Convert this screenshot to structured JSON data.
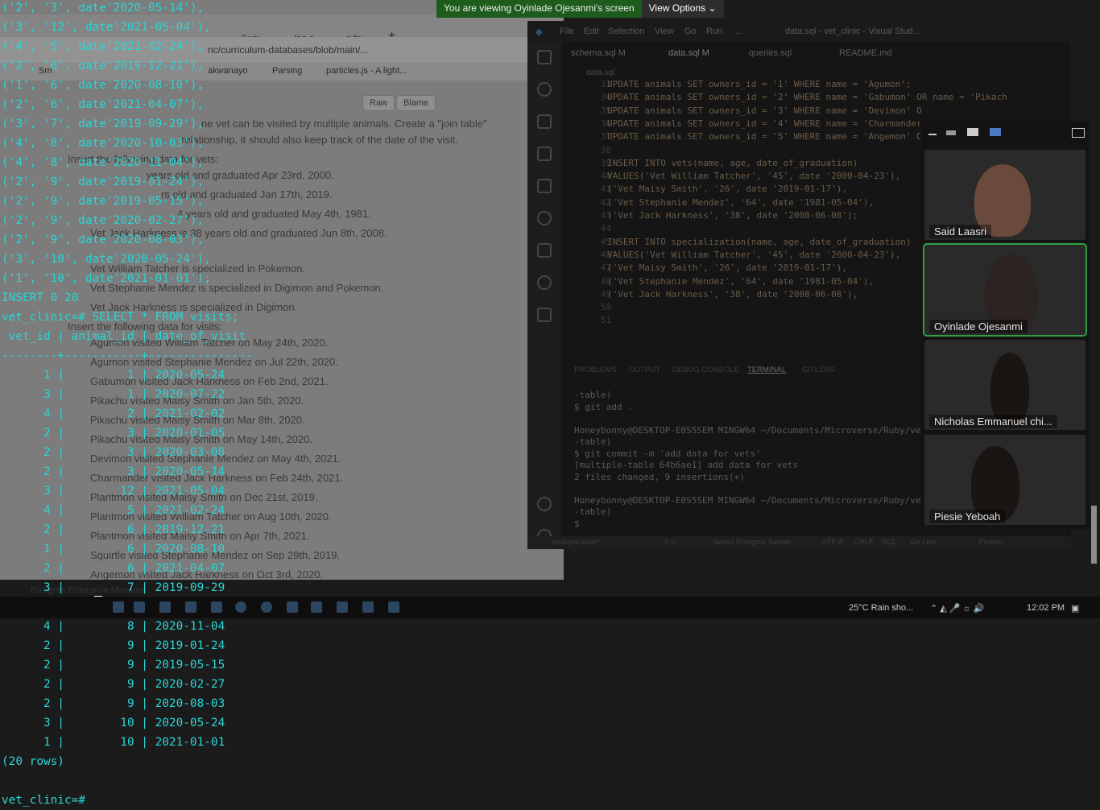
{
  "browser": {
    "tabs": [
      "Sum",
      "(no s",
      "ruby"
    ],
    "address": "nc/curriculum-databases/blob/main/...",
    "bookmarks": [
      "Sm",
      "akwanayo",
      "Parsing",
      "particles.js - A light..."
    ],
    "buttons": {
      "raw": "Raw",
      "blame": "Blame"
    },
    "doc_lines": [
      "ne vet can be visited by multiple animals. Create a \"join table\"",
      "relationship, it should also keep track of the date of the visit.",
      "Insert the following data for vets:",
      "years old and graduated Apr 23rd, 2000.",
      "rs old and graduated Jan 17th, 2019.",
      "4 years old and graduated May 4th, 1981.",
      "Vet Jack Harkness is 38 years old and graduated Jun 8th, 2008.",
      "Vet William Tatcher is specialized in Pokemon.",
      "Vet Stephanie Mendez is specialized in Digimon and Pokemon.",
      "Vet Jack Harkness is specialized in Digimon.",
      "Insert the following data for visits:",
      "Agumon visited William Tatcher on May 24th, 2020.",
      "Agumon visited Stephanie Mendez on Jul 22th, 2020.",
      "Gabumon visited Jack Harkness on Feb 2nd, 2021.",
      "Pikachu visited Maisy Smith on Jan 5th, 2020.",
      "Pikachu visited Maisy Smith on Mar 8th, 2020.",
      "Pikachu visited Maisy Smith on May 14th, 2020.",
      "Devimon visited Stephanie Mendez on May 4th, 2021.",
      "Charmander visited Jack Harkness on Feb 24th, 2021.",
      "Plantmon visited Maisy Smith on Dec 21st, 2019.",
      "Plantmon visited William Tatcher on Aug 10th, 2020.",
      "Plantmon visited Maisy Smith on Apr 7th, 2021.",
      "Squirtle visited Stephanie Mendez on Sep 29th, 2019.",
      "Angemon visited Jack Harkness on Oct 3rd, 2020."
    ],
    "pgadmin": "Postgres Enterprise Manager"
  },
  "vscode": {
    "menu": [
      "File",
      "Edit",
      "Selection",
      "View",
      "Go",
      "Run",
      "..."
    ],
    "window_title": "data.sql - vet_clinic - Visual Stud...",
    "tabs": [
      "schema.sql M",
      "data.sql M",
      "queries.sql",
      "README.md"
    ],
    "breadcrumb": "data.sql",
    "line_numbers": [
      "33",
      "34",
      "35",
      "36",
      "37",
      "38",
      "39",
      "40",
      "41",
      "42",
      "43",
      "44",
      "45",
      "46",
      "47",
      "48",
      "49",
      "50",
      "51",
      "52"
    ],
    "code_lines": [
      "UPDATE animals SET owners_id = '1' WHERE name = 'Agumon';",
      "UPDATE animals SET owners_id = '2' WHERE name = 'Gabumon' OR name = 'Pikach",
      "UPDATE animals SET owners_id = '3' WHERE name = 'Devimon' O",
      "UPDATE animals SET owners_id = '4' WHERE name = 'Charmander",
      "UPDATE animals SET owners_id = '5' WHERE name = 'Angemon' O",
      "",
      "INSERT INTO vets(name, age, date_of_graduation)",
      "VALUES('Vet William Tatcher', '45', date '2000-04-23'),",
      "('Vet Maisy Smith', '26', date '2019-01-17'),",
      "('Vet Stephanie Mendez', '64', date '1981-05-04'),",
      "('Vet Jack Harkness', '38', date '2008-06-08');",
      "",
      "INSERT INTO specialization(name, age, date_of_graduation)",
      "VALUES('Vet William Tatcher', '45', date '2000-04-23'),",
      "('Vet Maisy Smith', '26', date '2019-01-17'),",
      "('Vet Stephanie Mendez', '64', date '1981-05-04'),",
      "('Vet Jack Harkness', '38', date '2008-06-08'),",
      "",
      ""
    ],
    "panel_tabs": [
      "PROBLEMS",
      "OUTPUT",
      "DEBUG CONSOLE",
      "TERMINAL",
      "GITLENS"
    ],
    "terminal_lines": [
      "-table)",
      "$ git add .",
      "",
      "Honeybonny@DESKTOP-E0S5SEM MINGW64 ~/Documents/Microverse/Ruby/vet_clini",
      "-table)",
      "$ git commit -m 'add data for vets'",
      "[multiple-table 64b6ae1] add data for vets",
      " 2 files changed, 9 insertions(+)",
      "",
      "Honeybonny@DESKTOP-E0S5SEM MINGW64 ~/Documents/Microverse/Ruby/vet_clini",
      "-table)",
      "$ "
    ],
    "status": [
      "multiple-table*",
      "0 0",
      "Select Postgres Server",
      "UTF-8",
      "CRLF",
      "SQL",
      "Go Live",
      "Prettier"
    ]
  },
  "psql": {
    "lines": [
      "('2', '3', date'2020-05-14'),",
      "('3', '12', date'2021-05-04'),",
      "('4', '5', date'2021-02-24'),",
      "('2', '6', date'2019-12-21'),",
      "('1', '6', date'2020-08-10'),",
      "('2', '6', date'2021-04-07'),",
      "('3', '7', date'2019-09-29'),",
      "('4', '8', date'2020-10-03'),",
      "('4', '8', date'2020-11-04'),",
      "('2', '9', date'2019-01-24'),",
      "('2', '9', date'2019-05-15'),",
      "('2', '9', date'2020-02-27'),",
      "('2', '9', date'2020-08-03'),",
      "('3', '10', date'2020-05-24'),",
      "('1', '10', date'2021-01-01');",
      "INSERT 0 20",
      "vet_clinic=# SELECT * FROM visits;",
      " vet_id | animal_id | date_of_visit",
      "--------+-----------+---------------",
      "      1 |         1 | 2020-05-24",
      "      3 |         1 | 2020-07-22",
      "      4 |         2 | 2021-02-02",
      "      2 |         3 | 2020-01-05",
      "      2 |         3 | 2020-03-08",
      "      2 |         3 | 2020-05-14",
      "      3 |        12 | 2021-05-04",
      "      4 |         5 | 2021-02-24",
      "      2 |         6 | 2019-12-21",
      "      1 |         6 | 2020-08-10",
      "      2 |         6 | 2021-04-07",
      "      3 |         7 | 2019-09-29",
      "      4 |         8 | 2020-10-03",
      "      4 |         8 | 2020-11-04",
      "      2 |         9 | 2019-01-24",
      "      2 |         9 | 2019-05-15",
      "      2 |         9 | 2020-02-27",
      "      2 |         9 | 2020-08-03",
      "      3 |        10 | 2020-05-24",
      "      1 |        10 | 2021-01-01",
      "(20 rows)",
      "",
      "vet_clinic=# "
    ]
  },
  "zoom": {
    "banner_text": "You are viewing Oyinlade Ojesanmi's screen",
    "view_options": "View Options",
    "participants": [
      "Said Laasri",
      "Oyinlade Ojesanmi",
      "Nicholas Emmanuel chi...",
      "Piesie Yeboah"
    ]
  },
  "taskbar": {
    "weather": "25°C  Rain sho...",
    "time": "12:02 PM"
  },
  "colors": {
    "terminal_text": "#2bd5d5",
    "banner_green": "#1d5c1d",
    "active_speaker": "#2ea043"
  }
}
